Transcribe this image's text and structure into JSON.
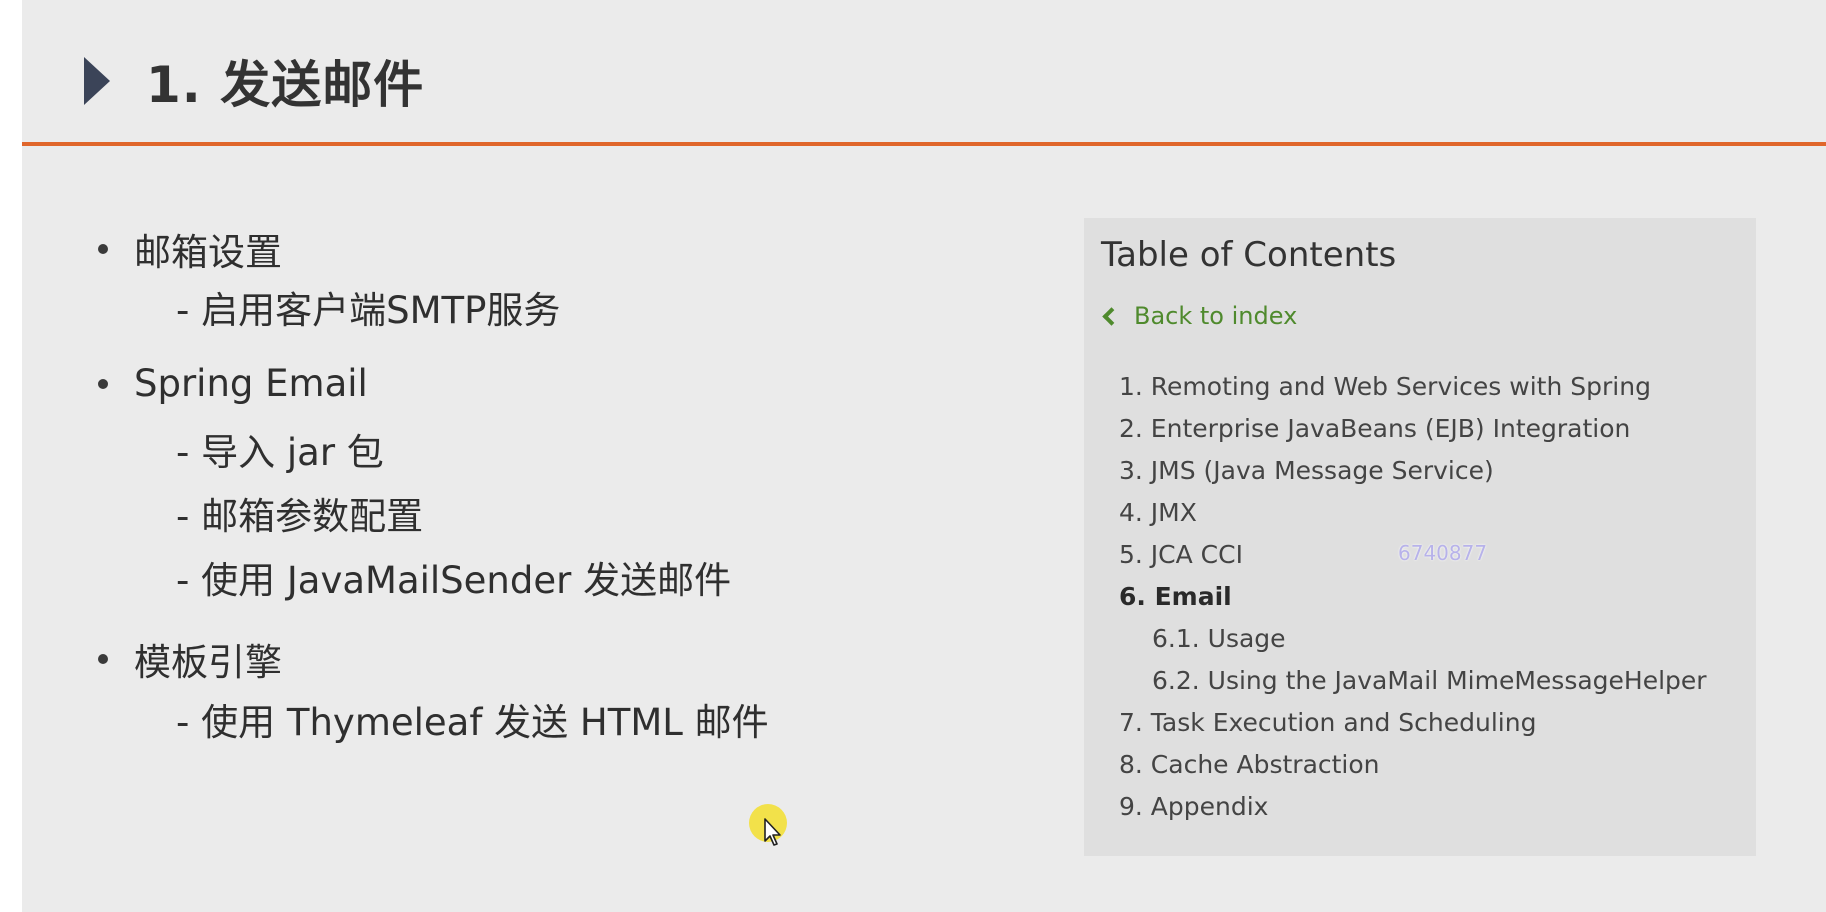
{
  "header": {
    "title": "1. 发送邮件"
  },
  "bullets": [
    {
      "label": "邮箱设置",
      "subs": [
        "- 启用客户端SMTP服务"
      ]
    },
    {
      "label": "Spring Email",
      "subs": [
        "-  导入 jar 包",
        "-  邮箱参数配置",
        "-  使用 JavaMailSender 发送邮件"
      ]
    },
    {
      "label": "模板引擎",
      "subs": [
        "- 使用 Thymeleaf 发送 HTML 邮件"
      ]
    }
  ],
  "toc": {
    "title": "Table of Contents",
    "back_label": "Back to index",
    "items": [
      {
        "label": "1. Remoting and Web Services with Spring"
      },
      {
        "label": "2. Enterprise JavaBeans (EJB) Integration"
      },
      {
        "label": "3. JMS (Java Message Service)"
      },
      {
        "label": "4. JMX"
      },
      {
        "label": "5. JCA CCI"
      },
      {
        "label": "6. Email",
        "active": true
      },
      {
        "label": "6.1. Usage"
      },
      {
        "label": "6.2. Using the JavaMail MimeMessageHelper"
      },
      {
        "label": "7. Task Execution and Scheduling"
      },
      {
        "label": "8. Cache Abstraction"
      },
      {
        "label": "9. Appendix"
      }
    ]
  },
  "watermark": "6740877",
  "colors": {
    "accent_rule": "#e0662b",
    "link_green": "#4f8a2d",
    "header_arrow": "#3b4458",
    "cursor_halo": "#f2e14a"
  },
  "icons": {
    "header": "play-arrow-icon",
    "back": "chevron-left-icon",
    "cursor": "mouse-pointer-icon"
  }
}
